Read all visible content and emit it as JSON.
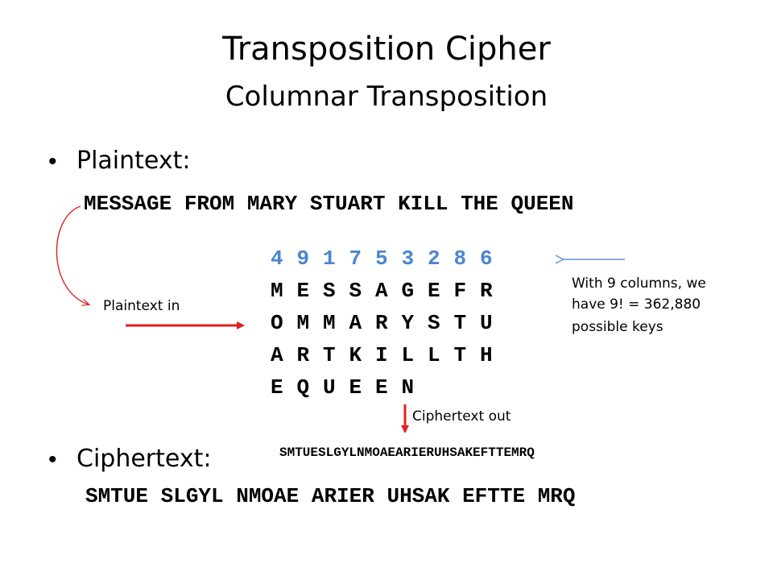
{
  "title": "Transposition Cipher",
  "subtitle": "Columnar Transposition",
  "bullets": {
    "plaintext_label": "Plaintext:",
    "ciphertext_label": "Ciphertext:"
  },
  "plaintext": "MESSAGE FROM MARY STUART KILL THE QUEEN",
  "grid": {
    "key": [
      "4",
      "9",
      "1",
      "7",
      "5",
      "3",
      "2",
      "8",
      "6"
    ],
    "rows": [
      [
        "M",
        "E",
        "S",
        "S",
        "A",
        "G",
        "E",
        "F",
        "R"
      ],
      [
        "O",
        "M",
        "M",
        "A",
        "R",
        "Y",
        "S",
        "T",
        "U"
      ],
      [
        "A",
        "R",
        "T",
        "K",
        "I",
        "L",
        "L",
        "T",
        "H"
      ],
      [
        "E",
        "Q",
        "U",
        "E",
        "E",
        "N"
      ]
    ]
  },
  "annotations": {
    "plaintext_in": "Plaintext in",
    "ciphertext_out": "Ciphertext out",
    "keys_note_line1": "With 9 columns, we",
    "keys_note_line2": "have 9! = 362,880",
    "keys_note_line3": "possible keys"
  },
  "ciphertext_compact": "SMTUESLGYLNMOAEARIERUHSAKEFTTEMRQ",
  "ciphertext_grouped": "SMTUE SLGYL NMOAE ARIER UHSAK EFTTE MRQ",
  "colors": {
    "key_digits": "#4a86d0",
    "red_arrow": "#e02020",
    "blue_arrow": "#4a7fc8"
  }
}
